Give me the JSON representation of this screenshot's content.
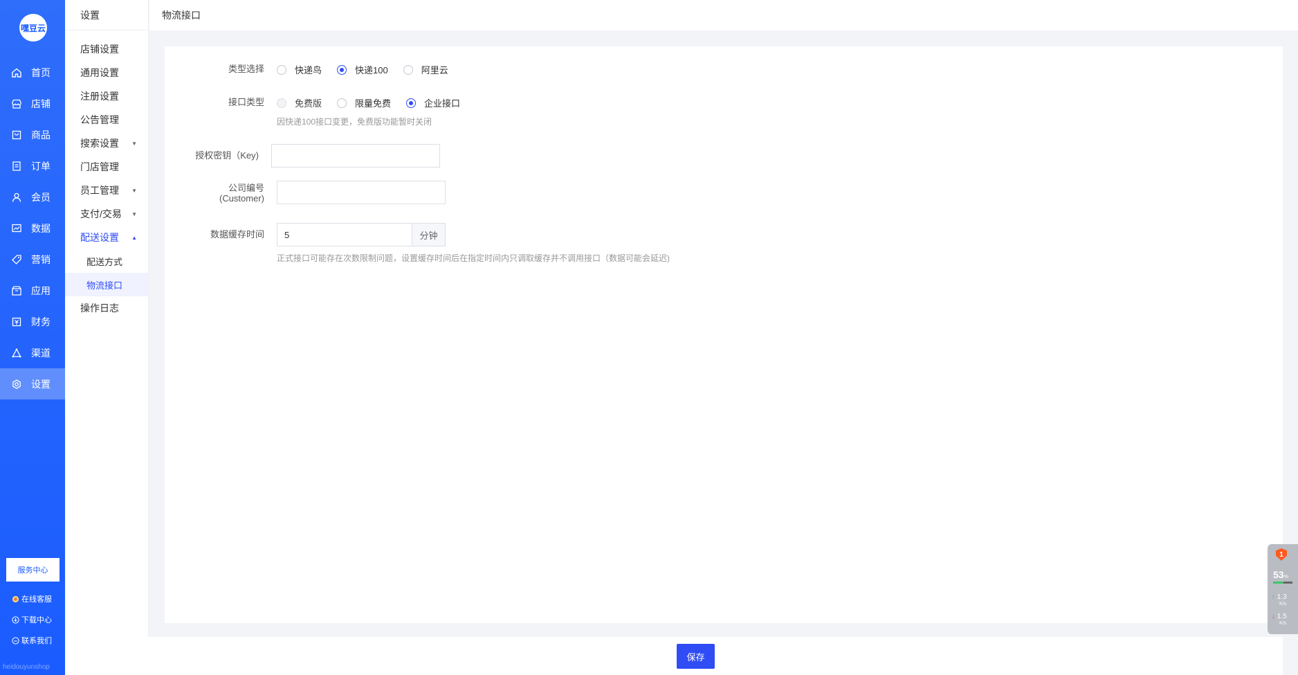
{
  "nav": {
    "logo": "嘿豆云",
    "items": [
      {
        "label": "首页",
        "icon": "home-icon"
      },
      {
        "label": "店铺",
        "icon": "store-icon"
      },
      {
        "label": "商品",
        "icon": "goods-icon"
      },
      {
        "label": "订单",
        "icon": "order-icon"
      },
      {
        "label": "会员",
        "icon": "user-icon"
      },
      {
        "label": "数据",
        "icon": "chart-icon"
      },
      {
        "label": "营销",
        "icon": "tag-icon"
      },
      {
        "label": "应用",
        "icon": "app-icon"
      },
      {
        "label": "财务",
        "icon": "finance-icon"
      },
      {
        "label": "渠道",
        "icon": "channel-icon"
      },
      {
        "label": "设置",
        "icon": "gear-icon"
      }
    ],
    "service_center": "服务中心",
    "online_support": "在线客服",
    "download_center": "下载中心",
    "contact_us": "联系我们",
    "brand_footer": "heidouyunshop"
  },
  "submenu": {
    "title": "设置",
    "items": [
      {
        "label": "店铺设置"
      },
      {
        "label": "通用设置"
      },
      {
        "label": "注册设置"
      },
      {
        "label": "公告管理"
      },
      {
        "label": "搜索设置"
      },
      {
        "label": "门店管理"
      },
      {
        "label": "员工管理"
      },
      {
        "label": "支付/交易"
      },
      {
        "label": "配送设置"
      },
      {
        "label": "配送方式"
      },
      {
        "label": "物流接口"
      },
      {
        "label": "操作日志"
      }
    ]
  },
  "breadcrumb": "物流接口",
  "form": {
    "type_label": "类型选择",
    "type_options": [
      "快递鸟",
      "快递100",
      "阿里云"
    ],
    "type_selected": "快递100",
    "api_label": "接口类型",
    "api_options": [
      "免费版",
      "限量免费",
      "企业接口"
    ],
    "api_selected": "企业接口",
    "api_hint": "因快递100接口变更，免费版功能暂时关闭",
    "key_label": "授权密钥（Key)",
    "key_value": "",
    "customer_label_1": "公司编号",
    "customer_label_2": "(Customer)",
    "customer_value": "",
    "cache_label": "数据缓存时间",
    "cache_value": "5",
    "cache_unit": "分钟",
    "cache_hint": "正式接口可能存在次数限制问题，设置缓存时间后在指定时间内只调取缓存并不调用接口（数据可能会延迟)"
  },
  "save_label": "保存",
  "widget": {
    "badge": "1",
    "percent": "53",
    "percent_unit": "%",
    "usage_fraction": 0.53,
    "upload": "1.3",
    "download": "1.5",
    "speed_unit": "K/s"
  },
  "colors": {
    "nav_blue": "#1a5cff",
    "accent": "#2f4cf5"
  }
}
